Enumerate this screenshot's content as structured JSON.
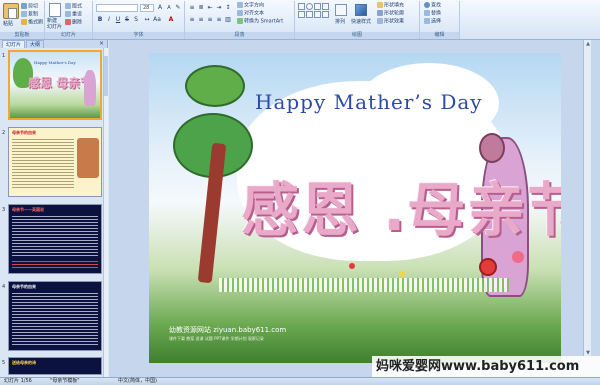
{
  "ribbon": {
    "groups": [
      {
        "label": "剪贴板"
      },
      {
        "label": "幻灯片"
      },
      {
        "label": "字体"
      },
      {
        "label": "段落"
      },
      {
        "label": "绘图"
      },
      {
        "label": "编辑"
      }
    ],
    "clipboard": {
      "paste": "粘贴",
      "cut": "剪切",
      "copy": "复制",
      "format_painter": "格式刷"
    },
    "slides": {
      "new_slide": "新建\n幻灯片",
      "layout": "版式",
      "reset": "重设",
      "delete": "删除"
    },
    "font": {
      "name": "",
      "size": "28"
    },
    "paragraph": {
      "text_direction": "文字方向",
      "align_text": "对齐文本",
      "convert_smartart": "转换为 SmartArt"
    },
    "drawing": {
      "arrange": "排列",
      "quick_styles": "快速样式",
      "shape_fill": "形状填充",
      "shape_outline": "形状轮廓",
      "shape_effects": "形状效果"
    },
    "editing": {
      "find": "查找",
      "replace": "替换",
      "select": "选择"
    }
  },
  "panel": {
    "tabs": [
      "幻灯片",
      "大纲"
    ],
    "close": "×",
    "thumbs": [
      {
        "num": "1",
        "title": "Happy Mather's Day",
        "cn": "感恩 母亲节"
      },
      {
        "num": "2",
        "head": "母亲节的由来"
      },
      {
        "num": "3",
        "head": "母亲节——英国说"
      },
      {
        "num": "4",
        "head": "母亲节的由来"
      },
      {
        "num": "5",
        "head": "送给母亲的诗"
      }
    ]
  },
  "slide": {
    "title": "Happy Mather’s Day",
    "cn_title": "感恩 .母亲节",
    "footer": "幼教资源网站 ziyuan.baby611.com",
    "footer_small": "课件下载 教案 说课 试题 PPT课件 学期计划 观察记录"
  },
  "watermark": "妈咪爱婴网www.baby611.com",
  "status": {
    "slide_info": "幻灯片 1/56",
    "theme": "\"母亲节模板\"",
    "language": "中文(简体，中国)"
  }
}
